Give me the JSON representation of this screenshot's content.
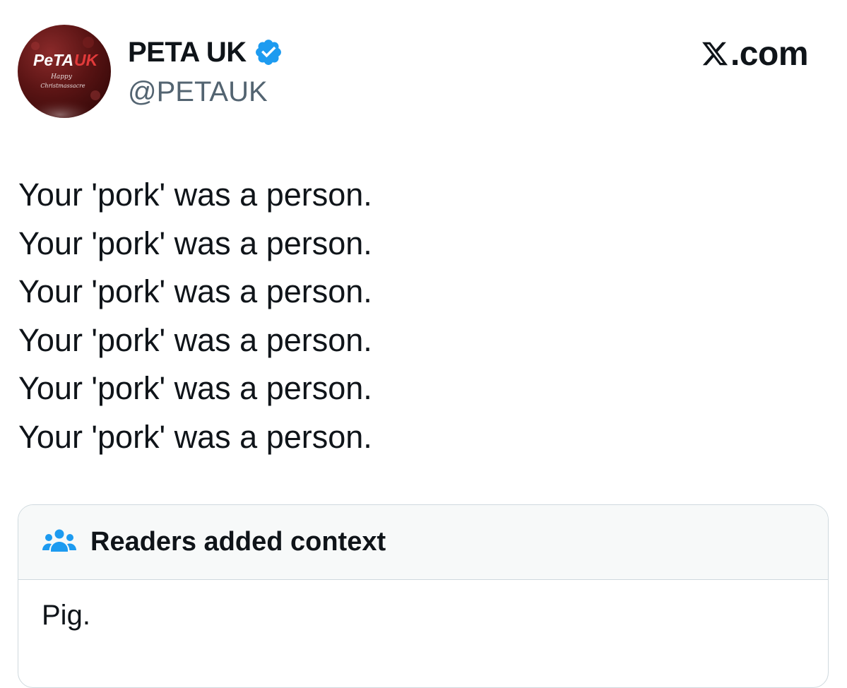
{
  "author": {
    "name": "PETA UK",
    "handle": "@PETAUK",
    "verified": true,
    "avatar_text": "PeTAUK",
    "avatar_subtext": "Happy Christmassacre"
  },
  "brand": {
    "label": ".com",
    "logo_icon": "x-logo-icon"
  },
  "tweet": {
    "lines": [
      "Your 'pork' was a person.",
      "Your 'pork' was a person.",
      "Your 'pork' was a person.",
      "Your 'pork' was a person.",
      "Your 'pork' was a person.",
      "Your 'pork' was a person."
    ]
  },
  "community_note": {
    "title": "Readers added context",
    "icon": "people-icon",
    "body": "Pig."
  },
  "colors": {
    "verified_badge": "#1d9bf0",
    "note_icon": "#1d9bf0",
    "handle_text": "#536471",
    "note_header_bg": "#f7f9f9",
    "border": "#cfd9de"
  }
}
